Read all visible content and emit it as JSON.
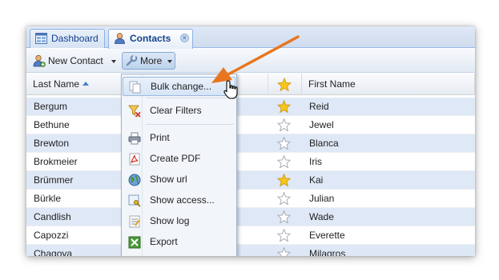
{
  "tabs": [
    {
      "label": "Dashboard",
      "icon": "dashboard-icon",
      "active": false
    },
    {
      "label": "Contacts",
      "icon": "contacts-icon",
      "active": true,
      "close": "×"
    }
  ],
  "toolbar": {
    "new_contact_label": "New Contact",
    "more_label": "More"
  },
  "grid": {
    "columns": {
      "last_name": "Last Name",
      "first_name": "First Name"
    },
    "rows": [
      {
        "last": "Bergum",
        "first": "Reid",
        "favorite": true
      },
      {
        "last": "Bethune",
        "first": "Jewel",
        "favorite": false
      },
      {
        "last": "Brewton",
        "first": "Blanca",
        "favorite": false
      },
      {
        "last": "Brokmeier",
        "first": "Iris",
        "favorite": false
      },
      {
        "last": "Brümmer",
        "first": "Kai",
        "favorite": true
      },
      {
        "last": "Bürkle",
        "first": "Julian",
        "favorite": false
      },
      {
        "last": "Candlish",
        "first": "Wade",
        "favorite": false
      },
      {
        "last": "Capozzi",
        "first": "Everette",
        "favorite": false
      },
      {
        "last": "Chagoya",
        "first": "Milagros",
        "favorite": false
      }
    ]
  },
  "menu": {
    "items": [
      {
        "label": "Bulk change...",
        "icon": "bulk-change-icon"
      },
      {
        "label": "Clear Filters",
        "icon": "clear-filters-icon"
      },
      {
        "label": "Print",
        "icon": "print-icon"
      },
      {
        "label": "Create PDF",
        "icon": "pdf-icon"
      },
      {
        "label": "Show url",
        "icon": "globe-icon"
      },
      {
        "label": "Show access...",
        "icon": "access-key-icon"
      },
      {
        "label": "Show log",
        "icon": "log-icon"
      },
      {
        "label": "Export",
        "icon": "export-icon"
      }
    ]
  },
  "colors": {
    "accent": "#15428b",
    "annotation_arrow": "#e8761f",
    "star_gold": "#f5c518",
    "row_highlight": "#dfe8f6"
  }
}
